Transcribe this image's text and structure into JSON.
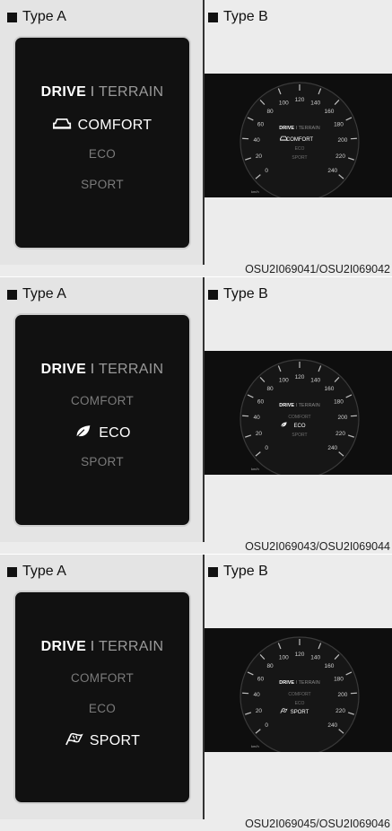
{
  "type_a_label": "Type A",
  "type_b_label": "Type B",
  "drive_label": "DRIVE",
  "separator": "I",
  "terrain_label": "TERRAIN",
  "modes": [
    "COMFORT",
    "ECO",
    "SPORT"
  ],
  "speed_ticks": [
    "0",
    "20",
    "40",
    "60",
    "80",
    "100",
    "120",
    "140",
    "160",
    "180",
    "200",
    "220",
    "240"
  ],
  "speed_unit": "km/h",
  "panels": [
    {
      "active_mode": "COMFORT",
      "active_icon": "comfort-car-icon",
      "caption": "OSU2I069041/OSU2I069042"
    },
    {
      "active_mode": "ECO",
      "active_icon": "eco-leaf-icon",
      "caption": "OSU2I069043/OSU2I069044"
    },
    {
      "active_mode": "SPORT",
      "active_icon": "sport-flag-icon",
      "caption": "OSU2I069045/OSU2I069046"
    }
  ],
  "colors": {
    "screen": "#111111",
    "active_text": "#ffffff",
    "inactive_text": "#7b7b7b",
    "divider": "#333333"
  }
}
